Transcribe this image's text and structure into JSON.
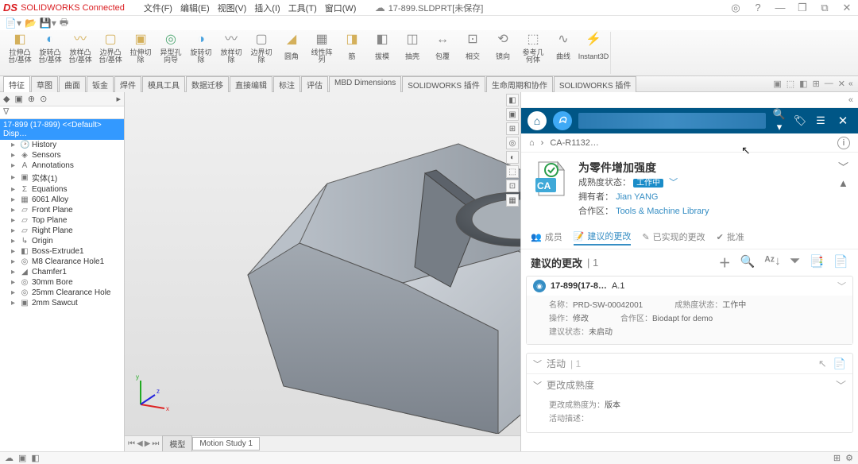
{
  "app": {
    "logo": "DS",
    "name": "SOLIDWORKS Connected",
    "doc_title": "17-899.SLDPRT[未保存]"
  },
  "menu": [
    "文件(F)",
    "编辑(E)",
    "视图(V)",
    "插入(I)",
    "工具(T)",
    "窗口(W)"
  ],
  "win_icons": {
    "user": "◎",
    "help": "?",
    "min": "—",
    "restore": "❐",
    "batch": "⧉",
    "close": "✕"
  },
  "ribbon_btns": [
    {
      "icon": "◧",
      "label": "拉伸凸\n台/基体",
      "color": "#d4b05b"
    },
    {
      "icon": "◐",
      "label": "旋转凸\n台/基体",
      "color": "#4aa3df"
    },
    {
      "icon": "〰",
      "label": "放样凸台/基体",
      "color": "#d4b05b"
    },
    {
      "icon": "▢",
      "label": "边界凸台/基体",
      "color": "#d4b05b"
    },
    {
      "icon": "▣",
      "label": "拉伸切\n除",
      "color": "#d4b05b"
    },
    {
      "icon": "◎",
      "label": "异型孔\n向导",
      "color": "#5a7"
    },
    {
      "icon": "◑",
      "label": "旋转切\n除",
      "color": "#4aa3df"
    },
    {
      "icon": "〰",
      "label": "放样切除",
      "color": "#888"
    },
    {
      "icon": "▢",
      "label": "边界切除",
      "color": "#888"
    },
    {
      "icon": "◢",
      "label": "圆角",
      "color": "#d4b05b"
    },
    {
      "icon": "▦",
      "label": "线性阵\n列",
      "color": "#888"
    },
    {
      "icon": "◨",
      "label": "筋",
      "color": "#d4b05b"
    },
    {
      "icon": "◧",
      "label": "拔模",
      "color": "#888"
    },
    {
      "icon": "◫",
      "label": "抽壳",
      "color": "#888"
    },
    {
      "icon": "↔",
      "label": "包覆",
      "color": "#888"
    },
    {
      "icon": "⊡",
      "label": "相交",
      "color": "#888"
    },
    {
      "icon": "⟲",
      "label": "镜向",
      "color": "#888"
    },
    {
      "icon": "⬚",
      "label": "参考几\n何体",
      "color": "#888"
    },
    {
      "icon": "∿",
      "label": "曲线",
      "color": "#888"
    },
    {
      "icon": "⚡",
      "label": "Instant3D",
      "color": "#f5a623"
    }
  ],
  "feature_tabs": [
    "特征",
    "草图",
    "曲面",
    "钣金",
    "焊件",
    "模具工具",
    "数据迁移",
    "直接编辑",
    "标注",
    "评估",
    "MBD Dimensions",
    "SOLIDWORKS 插件",
    "生命周期和协作",
    "SOLIDWORKS 插件"
  ],
  "feature_tabs_active": 0,
  "tree": {
    "root": "17-899 (17-899) <<Default> Disp…",
    "items": [
      {
        "icon": "🕑",
        "label": "History"
      },
      {
        "icon": "◈",
        "label": "Sensors"
      },
      {
        "icon": "A",
        "label": "Annotations"
      },
      {
        "icon": "▣",
        "label": "实体(1)"
      },
      {
        "icon": "Σ",
        "label": "Equations"
      },
      {
        "icon": "▦",
        "label": "6061 Alloy"
      },
      {
        "icon": "▱",
        "label": "Front Plane"
      },
      {
        "icon": "▱",
        "label": "Top Plane"
      },
      {
        "icon": "▱",
        "label": "Right Plane"
      },
      {
        "icon": "↳",
        "label": "Origin"
      },
      {
        "icon": "◧",
        "label": "Boss-Extrude1"
      },
      {
        "icon": "◎",
        "label": "M8 Clearance Hole1"
      },
      {
        "icon": "◢",
        "label": "Chamfer1"
      },
      {
        "icon": "◎",
        "label": "30mm Bore"
      },
      {
        "icon": "◎",
        "label": "25mm Clearance Hole"
      },
      {
        "icon": "▣",
        "label": "2mm Sawcut"
      }
    ]
  },
  "bottom_tabs": {
    "model": "模型",
    "motion": "Motion Study 1"
  },
  "triad": {
    "x": "x",
    "y": "y",
    "z": "z"
  },
  "panel3dx": {
    "crumb_home": "⌂",
    "crumb_item": "CA-R1132…",
    "card": {
      "title": "为零件增加强度",
      "maturity_label": "成熟度状态：",
      "maturity_badge": "工作中",
      "owner_label": "拥有者：",
      "owner": "Jian YANG",
      "coll_label": "合作区：",
      "coll": "Tools & Machine Library"
    },
    "subtabs": [
      {
        "icon": "👥",
        "label": "成员"
      },
      {
        "icon": "📝",
        "label": "建议的更改",
        "active": true
      },
      {
        "icon": "✎",
        "label": "已实现的更改"
      },
      {
        "icon": "✔",
        "label": "批准"
      }
    ],
    "section": {
      "title": "建议的更改",
      "count": "1"
    },
    "action_icons": [
      "＋",
      "🔍",
      "ᴬᶻ↓",
      "⏷",
      "📑",
      "📄"
    ],
    "change": {
      "title_a": "17-899(17-8…",
      "title_b": "A.1",
      "name_label": "名称：",
      "name": "PRD-SW-00042001",
      "maturity_label": "成熟度状态：",
      "maturity": "工作中",
      "op_label": "操作：",
      "op": "修改",
      "coll_label": "合作区：",
      "coll": "Biodapt for demo",
      "state_label": "建议状态：",
      "state": "未启动"
    },
    "activity": {
      "title": "活动",
      "count": "1",
      "line1": "更改成熟度",
      "line2_a": "更改成熟度为：",
      "line2_b": "版本",
      "line3": "活动描述："
    }
  }
}
